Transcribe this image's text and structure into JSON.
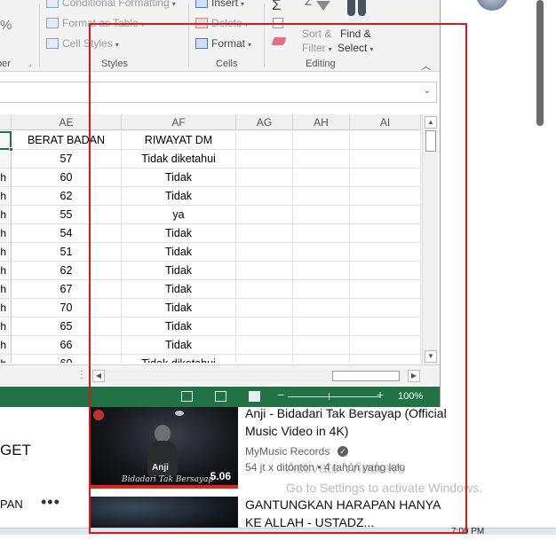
{
  "excel": {
    "ribbon": {
      "conditional_formatting": "Conditional Formatting",
      "format_as_table": "Format as Table",
      "cell_styles": "Cell Styles",
      "styles_group": "Styles",
      "insert": "Insert",
      "delete": "Delete",
      "format": "Format",
      "cells_group": "Cells",
      "sort_filter_l1": "Sort &",
      "sort_filter_l2": "Filter",
      "find_select_l1": "Find &",
      "find_select_l2": "Select",
      "editing_group": "Editing",
      "left_group_fragment": "per",
      "left_percent": "%",
      "collapse_glyph": "^"
    },
    "columns": [
      "AE",
      "AF",
      "AG",
      "AH",
      "AI"
    ],
    "header_row": [
      "BERAT BADAN",
      "RIWAYAT DM",
      "",
      "",
      ""
    ],
    "rows": [
      {
        "prefix": "",
        "ae": "57",
        "af": "Tidak diketahui"
      },
      {
        "prefix": "h",
        "ae": "60",
        "af": "Tidak"
      },
      {
        "prefix": "h",
        "ae": "62",
        "af": "Tidak"
      },
      {
        "prefix": "h",
        "ae": "55",
        "af": "ya"
      },
      {
        "prefix": "h",
        "ae": "54",
        "af": "Tidak"
      },
      {
        "prefix": "h",
        "ae": "51",
        "af": "Tidak"
      },
      {
        "prefix": "h",
        "ae": "62",
        "af": "Tidak"
      },
      {
        "prefix": "h",
        "ae": "67",
        "af": "Tidak"
      },
      {
        "prefix": "h",
        "ae": "70",
        "af": "Tidak"
      },
      {
        "prefix": "h",
        "ae": "65",
        "af": "Tidak"
      },
      {
        "prefix": "h",
        "ae": "66",
        "af": "Tidak"
      },
      {
        "prefix": "h",
        "ae": "60",
        "af": "Tidak diketahui"
      }
    ],
    "status": {
      "zoom": "100%"
    },
    "theme_color": "#217346"
  },
  "background": {
    "left_text_1": "GET",
    "left_text_2": "PAN",
    "more_glyph": "•••",
    "video1": {
      "title": "Anji - Bidadari Tak Bersayap (Official Music Video in 4K)",
      "channel": "MyMusic Records",
      "meta": "54 jt x ditonton • 4 tahun yang lalu",
      "duration": "5.06",
      "thumb_brand": "Anji",
      "thumb_script": "Bidadari Tak Bersayap"
    },
    "video2": {
      "title": "GANTUNGKAN HARAPAN HANYA KE ALLAH - USTADZ..."
    },
    "watermark": {
      "title": "Activate Windows",
      "subtitle": "Go to Settings to activate Windows."
    },
    "clock_fragment": "7:00 PM"
  },
  "annotation_color": "#d71a1a"
}
